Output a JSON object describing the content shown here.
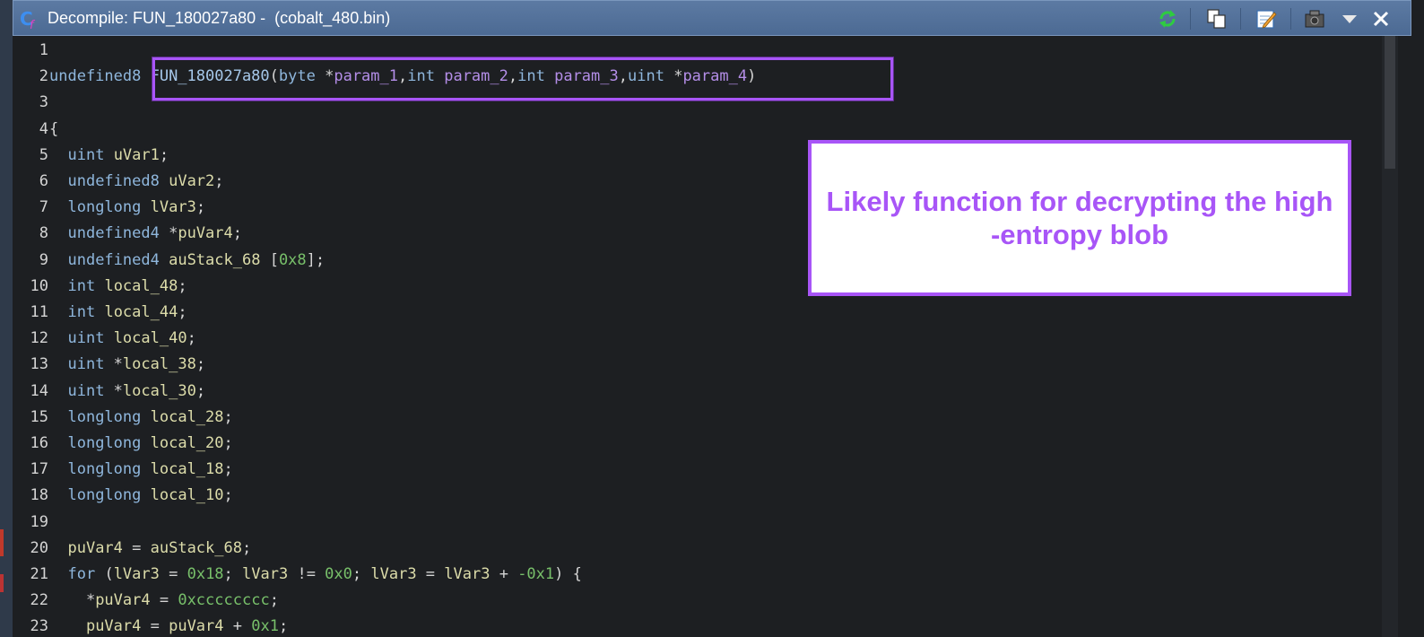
{
  "window": {
    "title": "Decompile: FUN_180027a80 -  (cobalt_480.bin)",
    "toolbar": [
      {
        "name": "refresh-icon"
      },
      {
        "name": "copy-icon"
      },
      {
        "name": "edit-icon"
      },
      {
        "name": "snapshot-icon"
      },
      {
        "name": "dropdown-icon"
      },
      {
        "name": "close-icon"
      }
    ]
  },
  "annotation": {
    "text": "Likely function for decrypting the high -entropy blob"
  },
  "colors": {
    "accent": "#a855f7",
    "keyword": "#8fb7dd",
    "variable": "#dcdcaa",
    "parameter": "#b48ee8",
    "number": "#78c06a"
  },
  "code": {
    "lines": [
      {
        "n": "1",
        "tokens": []
      },
      {
        "n": "2",
        "tokens": [
          {
            "t": "ty",
            "v": "undefined8 "
          },
          {
            "t": "fn",
            "v": "FUN_180027a80"
          },
          {
            "t": "pu",
            "v": "("
          },
          {
            "t": "ty",
            "v": "byte"
          },
          {
            "t": "pu",
            "v": " *"
          },
          {
            "t": "pa",
            "v": "param_1"
          },
          {
            "t": "pu",
            "v": ","
          },
          {
            "t": "ty",
            "v": "int"
          },
          {
            "t": "pu",
            "v": " "
          },
          {
            "t": "pa",
            "v": "param_2"
          },
          {
            "t": "pu",
            "v": ","
          },
          {
            "t": "ty",
            "v": "int"
          },
          {
            "t": "pu",
            "v": " "
          },
          {
            "t": "pa",
            "v": "param_3"
          },
          {
            "t": "pu",
            "v": ","
          },
          {
            "t": "ty",
            "v": "uint"
          },
          {
            "t": "pu",
            "v": " *"
          },
          {
            "t": "pa",
            "v": "param_4"
          },
          {
            "t": "pu",
            "v": ")"
          }
        ]
      },
      {
        "n": "3",
        "tokens": []
      },
      {
        "n": "4",
        "tokens": [
          {
            "t": "pu",
            "v": "{"
          }
        ]
      },
      {
        "n": "5",
        "tokens": [
          {
            "t": "pu",
            "v": "  "
          },
          {
            "t": "ty",
            "v": "uint"
          },
          {
            "t": "pu",
            "v": " "
          },
          {
            "t": "va",
            "v": "uVar1"
          },
          {
            "t": "pu",
            "v": ";"
          }
        ]
      },
      {
        "n": "6",
        "tokens": [
          {
            "t": "pu",
            "v": "  "
          },
          {
            "t": "ty",
            "v": "undefined8"
          },
          {
            "t": "pu",
            "v": " "
          },
          {
            "t": "va",
            "v": "uVar2"
          },
          {
            "t": "pu",
            "v": ";"
          }
        ]
      },
      {
        "n": "7",
        "tokens": [
          {
            "t": "pu",
            "v": "  "
          },
          {
            "t": "ty",
            "v": "longlong"
          },
          {
            "t": "pu",
            "v": " "
          },
          {
            "t": "va",
            "v": "lVar3"
          },
          {
            "t": "pu",
            "v": ";"
          }
        ]
      },
      {
        "n": "8",
        "tokens": [
          {
            "t": "pu",
            "v": "  "
          },
          {
            "t": "ty",
            "v": "undefined4"
          },
          {
            "t": "pu",
            "v": " *"
          },
          {
            "t": "va",
            "v": "puVar4"
          },
          {
            "t": "pu",
            "v": ";"
          }
        ]
      },
      {
        "n": "9",
        "tokens": [
          {
            "t": "pu",
            "v": "  "
          },
          {
            "t": "ty",
            "v": "undefined4"
          },
          {
            "t": "pu",
            "v": " "
          },
          {
            "t": "va",
            "v": "auStack_68"
          },
          {
            "t": "pu",
            "v": " ["
          },
          {
            "t": "nu",
            "v": "0x8"
          },
          {
            "t": "pu",
            "v": "];"
          }
        ]
      },
      {
        "n": "10",
        "tokens": [
          {
            "t": "pu",
            "v": "  "
          },
          {
            "t": "ty",
            "v": "int"
          },
          {
            "t": "pu",
            "v": " "
          },
          {
            "t": "va",
            "v": "local_48"
          },
          {
            "t": "pu",
            "v": ";"
          }
        ]
      },
      {
        "n": "11",
        "tokens": [
          {
            "t": "pu",
            "v": "  "
          },
          {
            "t": "ty",
            "v": "int"
          },
          {
            "t": "pu",
            "v": " "
          },
          {
            "t": "va",
            "v": "local_44"
          },
          {
            "t": "pu",
            "v": ";"
          }
        ]
      },
      {
        "n": "12",
        "tokens": [
          {
            "t": "pu",
            "v": "  "
          },
          {
            "t": "ty",
            "v": "uint"
          },
          {
            "t": "pu",
            "v": " "
          },
          {
            "t": "va",
            "v": "local_40"
          },
          {
            "t": "pu",
            "v": ";"
          }
        ]
      },
      {
        "n": "13",
        "tokens": [
          {
            "t": "pu",
            "v": "  "
          },
          {
            "t": "ty",
            "v": "uint"
          },
          {
            "t": "pu",
            "v": " *"
          },
          {
            "t": "va",
            "v": "local_38"
          },
          {
            "t": "pu",
            "v": ";"
          }
        ]
      },
      {
        "n": "14",
        "tokens": [
          {
            "t": "pu",
            "v": "  "
          },
          {
            "t": "ty",
            "v": "uint"
          },
          {
            "t": "pu",
            "v": " *"
          },
          {
            "t": "va",
            "v": "local_30"
          },
          {
            "t": "pu",
            "v": ";"
          }
        ]
      },
      {
        "n": "15",
        "tokens": [
          {
            "t": "pu",
            "v": "  "
          },
          {
            "t": "ty",
            "v": "longlong"
          },
          {
            "t": "pu",
            "v": " "
          },
          {
            "t": "va",
            "v": "local_28"
          },
          {
            "t": "pu",
            "v": ";"
          }
        ]
      },
      {
        "n": "16",
        "tokens": [
          {
            "t": "pu",
            "v": "  "
          },
          {
            "t": "ty",
            "v": "longlong"
          },
          {
            "t": "pu",
            "v": " "
          },
          {
            "t": "va",
            "v": "local_20"
          },
          {
            "t": "pu",
            "v": ";"
          }
        ]
      },
      {
        "n": "17",
        "tokens": [
          {
            "t": "pu",
            "v": "  "
          },
          {
            "t": "ty",
            "v": "longlong"
          },
          {
            "t": "pu",
            "v": " "
          },
          {
            "t": "va",
            "v": "local_18"
          },
          {
            "t": "pu",
            "v": ";"
          }
        ]
      },
      {
        "n": "18",
        "tokens": [
          {
            "t": "pu",
            "v": "  "
          },
          {
            "t": "ty",
            "v": "longlong"
          },
          {
            "t": "pu",
            "v": " "
          },
          {
            "t": "va",
            "v": "local_10"
          },
          {
            "t": "pu",
            "v": ";"
          }
        ]
      },
      {
        "n": "19",
        "tokens": []
      },
      {
        "n": "20",
        "tokens": [
          {
            "t": "pu",
            "v": "  "
          },
          {
            "t": "va",
            "v": "puVar4"
          },
          {
            "t": "pu",
            "v": " = "
          },
          {
            "t": "va",
            "v": "auStack_68"
          },
          {
            "t": "pu",
            "v": ";"
          }
        ]
      },
      {
        "n": "21",
        "tokens": [
          {
            "t": "pu",
            "v": "  "
          },
          {
            "t": "kw",
            "v": "for"
          },
          {
            "t": "pu",
            "v": " ("
          },
          {
            "t": "va",
            "v": "lVar3"
          },
          {
            "t": "pu",
            "v": " = "
          },
          {
            "t": "nu",
            "v": "0x18"
          },
          {
            "t": "pu",
            "v": "; "
          },
          {
            "t": "va",
            "v": "lVar3"
          },
          {
            "t": "pu",
            "v": " != "
          },
          {
            "t": "nu",
            "v": "0x0"
          },
          {
            "t": "pu",
            "v": "; "
          },
          {
            "t": "va",
            "v": "lVar3"
          },
          {
            "t": "pu",
            "v": " = "
          },
          {
            "t": "va",
            "v": "lVar3"
          },
          {
            "t": "pu",
            "v": " + "
          },
          {
            "t": "nu",
            "v": "-0x1"
          },
          {
            "t": "pu",
            "v": ") {"
          }
        ]
      },
      {
        "n": "22",
        "tokens": [
          {
            "t": "pu",
            "v": "    *"
          },
          {
            "t": "va",
            "v": "puVar4"
          },
          {
            "t": "pu",
            "v": " = "
          },
          {
            "t": "nu",
            "v": "0xcccccccc"
          },
          {
            "t": "pu",
            "v": ";"
          }
        ]
      },
      {
        "n": "23",
        "tokens": [
          {
            "t": "pu",
            "v": "    "
          },
          {
            "t": "va",
            "v": "puVar4"
          },
          {
            "t": "pu",
            "v": " = "
          },
          {
            "t": "va",
            "v": "puVar4"
          },
          {
            "t": "pu",
            "v": " + "
          },
          {
            "t": "nu",
            "v": "0x1"
          },
          {
            "t": "pu",
            "v": ";"
          }
        ]
      }
    ]
  }
}
